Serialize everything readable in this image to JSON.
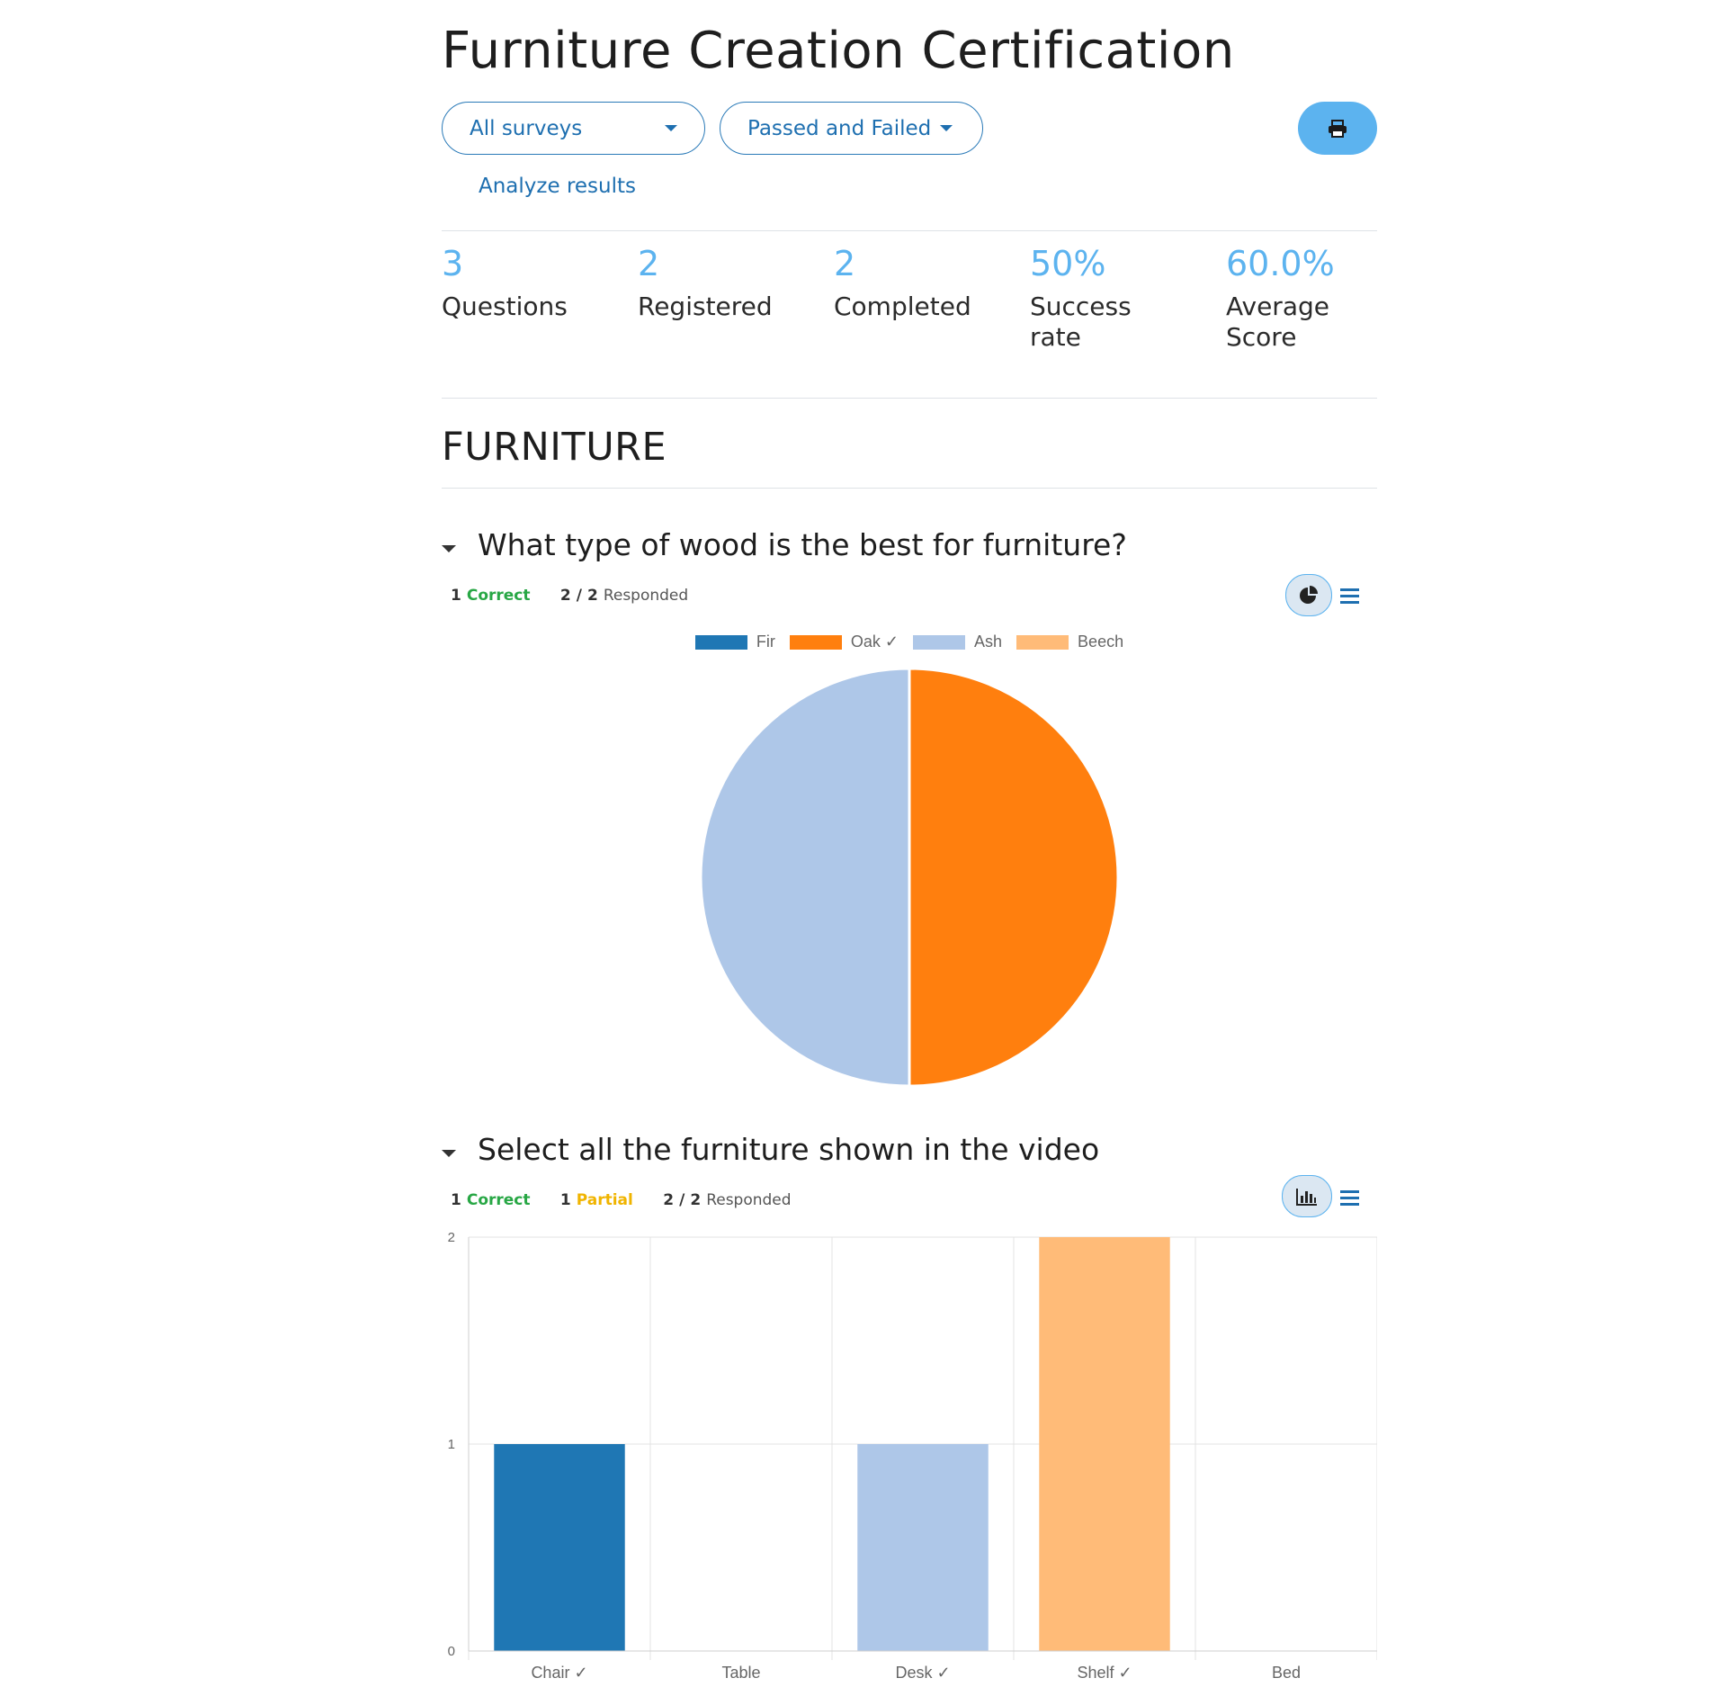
{
  "page": {
    "title": "Furniture Creation Certification",
    "filters": {
      "surveys": "All surveys",
      "status": "Passed and Failed"
    },
    "print_icon": "printer-icon",
    "analyze_link": "Analyze results"
  },
  "stats": [
    {
      "value": "3",
      "label": "Questions"
    },
    {
      "value": "2",
      "label": "Registered"
    },
    {
      "value": "2",
      "label": "Completed"
    },
    {
      "value": "50%",
      "label": "Success rate"
    },
    {
      "value": "60.0%",
      "label": "Average Score"
    }
  ],
  "section": {
    "title": "FURNITURE"
  },
  "questions": [
    {
      "title": "What type of wood is the best for furniture?",
      "correct_count": "1",
      "correct_label": "Correct",
      "responded": "2",
      "total": "2",
      "responded_label": "Responded",
      "view_icon": "pie-chart-icon",
      "list_icon": "list-icon"
    },
    {
      "title": "Select all the furniture shown in the video",
      "correct_count": "1",
      "correct_label": "Correct",
      "partial_count": "1",
      "partial_label": "Partial",
      "responded": "2",
      "total": "2",
      "responded_label": "Responded",
      "view_icon": "bar-chart-icon",
      "list_icon": "list-icon"
    }
  ],
  "colors": {
    "accent": "#5cb3ef",
    "link": "#1e6fb0",
    "correct": "#28a745",
    "partial": "#f0b400",
    "fir": "#1f77b4",
    "oak": "#ff7f0e",
    "ash": "#aec7e8",
    "beech": "#ffbb78"
  },
  "chart_data": [
    {
      "type": "pie",
      "categories": [
        "Fir",
        "Oak ✓",
        "Ash",
        "Beech"
      ],
      "values": [
        0,
        1,
        1,
        0
      ],
      "colors": [
        "#1f77b4",
        "#ff7f0e",
        "#aec7e8",
        "#ffbb78"
      ],
      "legend": "top"
    },
    {
      "type": "bar",
      "categories": [
        "Chair ✓",
        "Table",
        "Desk ✓",
        "Shelf ✓",
        "Bed"
      ],
      "values": [
        1,
        0,
        1,
        2,
        0
      ],
      "colors": [
        "#1f77b4",
        "#ff7f0e",
        "#aec7e8",
        "#ffbb78",
        "#2ca02c"
      ],
      "ylim": [
        0,
        2
      ],
      "yticks": [
        0,
        1,
        2
      ],
      "grid": true
    }
  ]
}
